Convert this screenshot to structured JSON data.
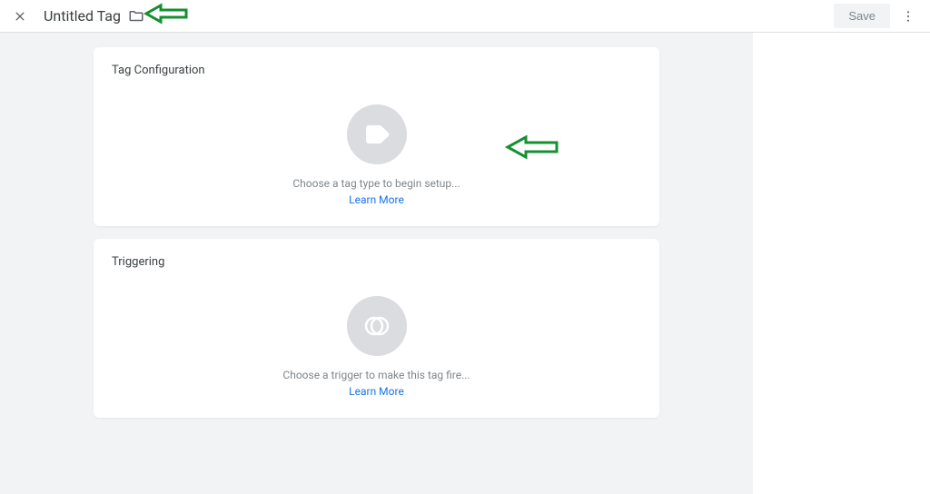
{
  "header": {
    "title": "Untitled Tag",
    "save_label": "Save"
  },
  "cards": {
    "tag_config": {
      "title": "Tag Configuration",
      "hint": "Choose a tag type to begin setup...",
      "learn_more": "Learn More"
    },
    "triggering": {
      "title": "Triggering",
      "hint": "Choose a trigger to make this tag fire...",
      "learn_more": "Learn More"
    }
  },
  "annotations": {
    "arrow_color": "#149031"
  }
}
